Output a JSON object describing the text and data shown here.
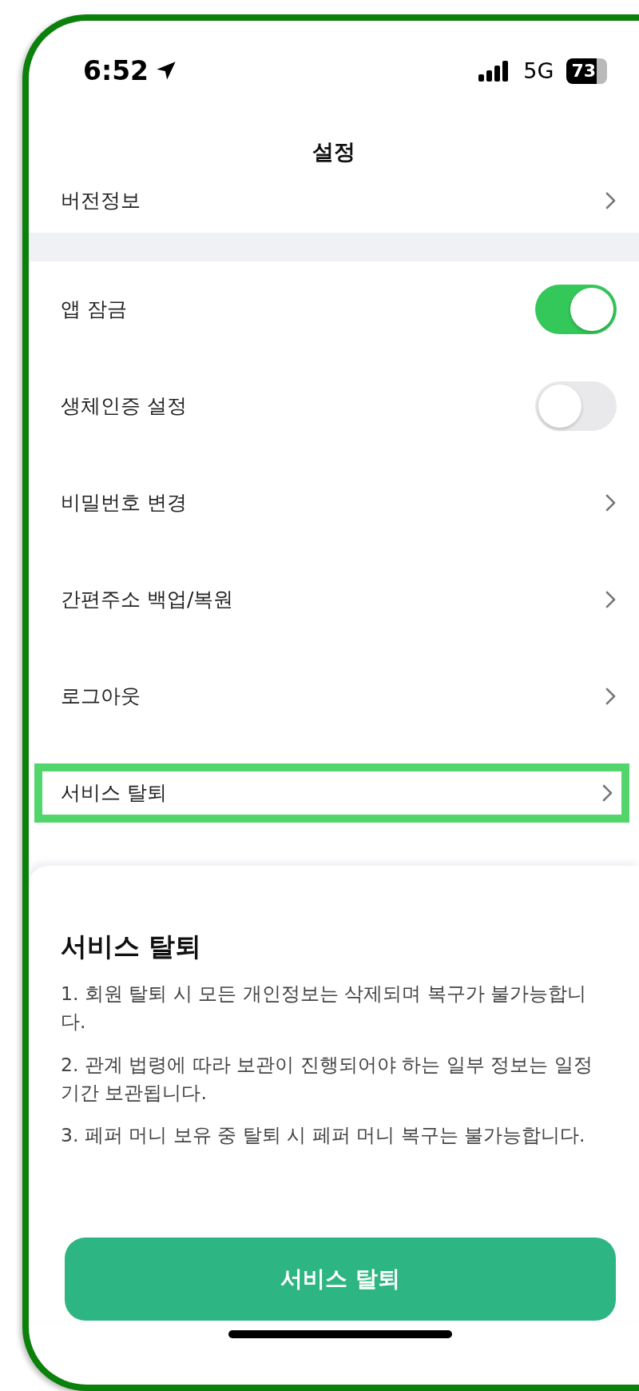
{
  "status_bar": {
    "time": "6:52",
    "network": "5G",
    "battery": "73"
  },
  "header": {
    "title": "설정"
  },
  "top_item": {
    "label": "버전정보",
    "kind": "link"
  },
  "items": [
    {
      "label": "앱 잠금",
      "kind": "toggle",
      "on": true,
      "highlighted": false
    },
    {
      "label": "생체인증 설정",
      "kind": "toggle",
      "on": false,
      "highlighted": false
    },
    {
      "label": "비밀번호 변경",
      "kind": "link",
      "highlighted": false
    },
    {
      "label": "간편주소 백업/복원",
      "kind": "link",
      "highlighted": false
    },
    {
      "label": "로그아웃",
      "kind": "link",
      "highlighted": false
    },
    {
      "label": "서비스 탈퇴",
      "kind": "link",
      "highlighted": true
    }
  ],
  "sheet": {
    "title": "서비스 탈퇴",
    "notes": [
      "1. 회원 탈퇴 시 모든 개인정보는 삭제되며 복구가 불가능합니다.",
      "2. 관계 법령에 따라 보관이 진행되어야 하는 일부 정보는 일정 기간 보관됩니다.",
      "3. 페퍼 머니 보유 중 탈퇴 시 페퍼 머니 복구는 불가능합니다."
    ],
    "button": "서비스 탈퇴"
  }
}
